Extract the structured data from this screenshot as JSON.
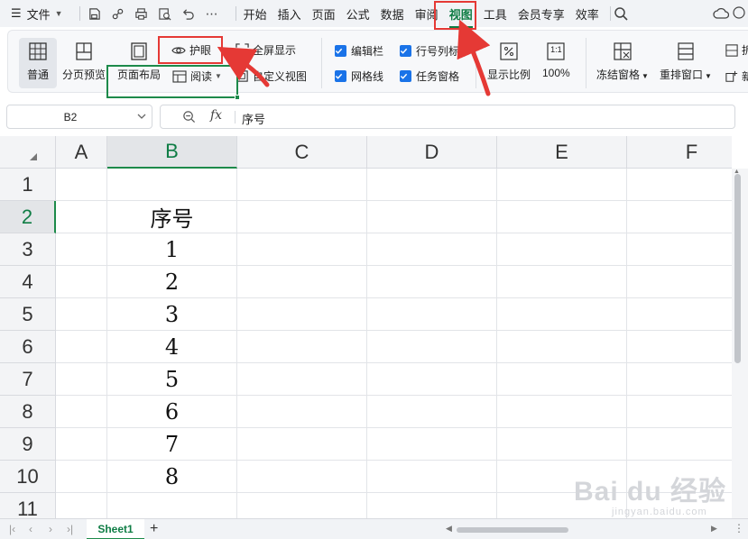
{
  "menubar": {
    "file_label": "文件",
    "tabs": [
      "开始",
      "插入",
      "页面",
      "公式",
      "数据",
      "审阅",
      "视图",
      "工具",
      "会员专享",
      "效率"
    ],
    "active_tab": "视图"
  },
  "ribbon": {
    "normal": "普通",
    "page_break_preview": "分页预览",
    "page_layout": "页面布局",
    "eye_care": "护眼",
    "reading": "阅读",
    "full_screen": "全屏显示",
    "custom_view": "自定义视图",
    "formula_bar": "编辑栏",
    "gridlines": "网格线",
    "row_col_headers": "行号列标",
    "task_pane": "任务窗格",
    "zoom_ratio": "显示比例",
    "zoom_100": "100%",
    "freeze_panes": "冻结窗格",
    "arrange_window": "重排窗口",
    "split_partial": "拆",
    "new_partial": "新",
    "zoom_icon_text": "1:1"
  },
  "formula": {
    "name_box": "B2",
    "fx": "fx",
    "content": "序号"
  },
  "grid": {
    "columns": [
      "A",
      "B",
      "C",
      "D",
      "E",
      "F"
    ],
    "rows": [
      "1",
      "2",
      "3",
      "4",
      "5",
      "6",
      "7",
      "8",
      "9",
      "10",
      "11"
    ],
    "b_values": [
      "",
      "序号",
      "1",
      "2",
      "3",
      "4",
      "5",
      "6",
      "7",
      "8",
      ""
    ]
  },
  "sheets": {
    "active": "Sheet1",
    "add": "+"
  },
  "watermark": {
    "brand": "Bai du 经验",
    "url": "jingyan.baidu.com"
  },
  "colors": {
    "accent_green": "#0f7d45",
    "highlight_red": "#e53935",
    "checkbox_blue": "#1a73e8"
  }
}
